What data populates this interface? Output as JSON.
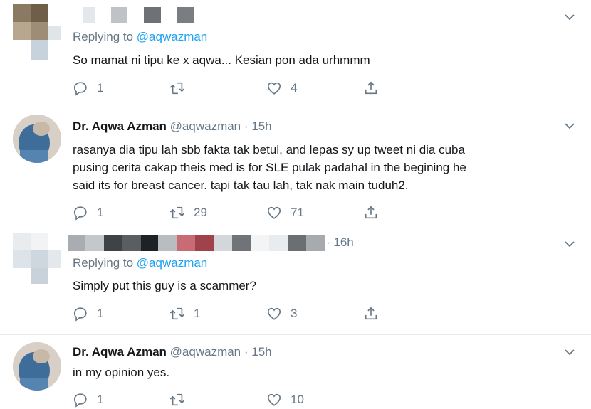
{
  "tweets": [
    {
      "reply_prefix": "Replying to",
      "reply_to": "@aqwazman",
      "text": "So mamat ni tipu ke x aqwa... Kesian pon ada urhmmm",
      "reply_count": "1",
      "retweet_count": "",
      "like_count": "4"
    },
    {
      "name": "Dr. Aqwa Azman",
      "handle": "@aqwazman",
      "time": "· 15h",
      "lines": [
        "rasanya dia tipu lah sbb fakta tak betul, and lepas sy up tweet ni dia cuba",
        "pusing cerita cakap theis med is for SLE pulak padahal in the begining he",
        "said its for breast cancer. tapi tak tau lah, tak nak main tuduh2."
      ],
      "reply_count": "1",
      "retweet_count": "29",
      "like_count": "71"
    },
    {
      "time": "· 16h",
      "reply_prefix": "Replying to",
      "reply_to": "@aqwazman",
      "text": "Simply put this guy is a scammer?",
      "reply_count": "1",
      "retweet_count": "1",
      "like_count": "3"
    },
    {
      "name": "Dr. Aqwa Azman",
      "handle": "@aqwazman",
      "time": "· 15h",
      "text": "in my opinion yes.",
      "reply_count": "1",
      "retweet_count": "",
      "like_count": "10"
    }
  ],
  "colors": {
    "secondary": "#657786",
    "link": "#1da1f2",
    "divider": "#e6ecf0"
  },
  "icons": [
    "reply-icon",
    "retweet-icon",
    "like-icon",
    "share-icon",
    "chevron-down-icon"
  ]
}
